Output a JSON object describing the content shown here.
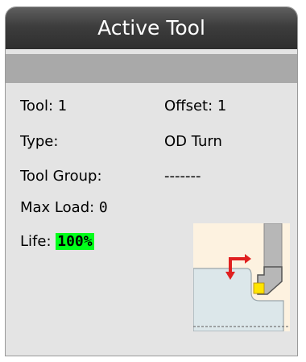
{
  "panel": {
    "title": "Active Tool",
    "fields": {
      "tool_label": "Tool:",
      "tool_value": "1",
      "offset_label": "Offset:",
      "offset_value": "1",
      "type_label": "Type:",
      "type_value": "OD Turn",
      "group_label": "Tool Group:",
      "group_value": "-------",
      "maxload_label": "Max Load:",
      "maxload_value": "0",
      "life_label": "Life:",
      "life_value": "100%"
    },
    "colors": {
      "title_bg": "#3d3d3d",
      "subbar_bg": "#a9a9a9",
      "panel_bg": "#e4e4e4",
      "life_highlight": "#00ff1a",
      "insert": "#ffe400",
      "direction_arrow": "#e02020"
    },
    "thumbnail_icon": "od-turn-tool-icon"
  }
}
